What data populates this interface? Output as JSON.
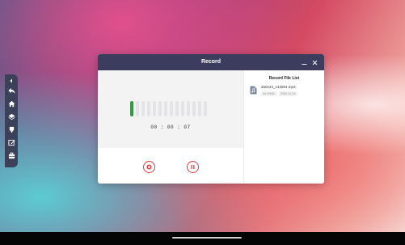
{
  "window": {
    "title": "Record",
    "minimize_icon": "minimize-icon",
    "close_icon": "close-icon"
  },
  "recorder": {
    "timer": "00 : 00 : 07",
    "level_total_bars": 14,
    "level_active_bars": 1,
    "level_active_color": "#2f9e3e",
    "stop_icon": "stop-icon",
    "pause_icon": "pause-icon",
    "accent_color": "#e23c3c"
  },
  "file_list": {
    "title": "Record File List",
    "items": [
      {
        "name": "250124_144804.mp3",
        "size": "94.09KB",
        "date": "2025.01.24",
        "icon": "audio-file-icon"
      }
    ]
  },
  "side_toolbar": {
    "items": [
      "collapse-arrow-icon",
      "back-icon",
      "home-icon",
      "layers-icon",
      "pen-icon",
      "edit-icon",
      "toolbox-icon"
    ]
  }
}
